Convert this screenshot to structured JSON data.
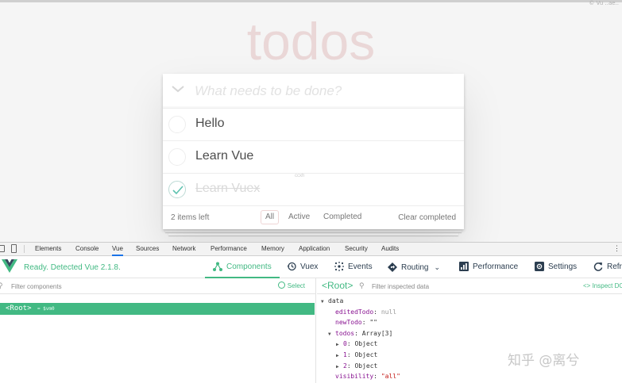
{
  "app": {
    "corner_text": "© Vu ..ae..",
    "title": "todos",
    "new_todo_placeholder": "What needs to be done?",
    "toggle_all_glyph": "❯",
    "todos": [
      {
        "title": "Hello",
        "completed": false
      },
      {
        "title": "Learn Vue",
        "completed": false
      },
      {
        "title": "Learn Vuex",
        "completed": true
      }
    ],
    "mid_watermark": "ccxh",
    "footer": {
      "items_left": "2 items left",
      "filters": [
        "All",
        "Active",
        "Completed"
      ],
      "selected_filter": "All",
      "clear_completed": "Clear completed"
    },
    "colors": {
      "title": "#e8c9c9",
      "check": "#5dc2af"
    }
  },
  "devtools": {
    "tabs": [
      "Elements",
      "Console",
      "Vue",
      "Sources",
      "Network",
      "Performance",
      "Memory",
      "Application",
      "Security",
      "Audits"
    ],
    "active_tab": "Vue",
    "menu_glyph": "⋮",
    "vue": {
      "ready_text": "Ready. Detected Vue 2.1.8.",
      "tabs": [
        {
          "label": "Components",
          "icon": "components-icon",
          "active": true
        },
        {
          "label": "Vuex",
          "icon": "history-icon",
          "active": false
        },
        {
          "label": "Events",
          "icon": "events-icon",
          "active": false
        },
        {
          "label": "Routing",
          "icon": "routing-icon",
          "active": false
        },
        {
          "label": "Performance",
          "icon": "performance-icon",
          "active": false
        },
        {
          "label": "Settings",
          "icon": "settings-icon",
          "active": false
        },
        {
          "label": "Refresh",
          "icon": "refresh-icon",
          "active": false
        }
      ],
      "filter_components_placeholder": "Filter components",
      "select_label": "Select",
      "root_component": "<Root>",
      "root_var": "= $vm0",
      "inspected_tag": "<Root>",
      "filter_inspected_placeholder": "Filter inspected data",
      "inspect_dom": "<> Inspect DOM",
      "data_tree": {
        "section": "data",
        "edited_key": "editedTodo",
        "edited_val": "null",
        "newtodo_key": "newTodo",
        "newtodo_val": "\"\"",
        "todos_key": "todos",
        "todos_val": "Array[3]",
        "items": [
          {
            "key": "0",
            "val": "Object"
          },
          {
            "key": "1",
            "val": "Object"
          },
          {
            "key": "2",
            "val": "Object"
          }
        ],
        "visibility_key": "visibility",
        "visibility_val": "\"all\""
      },
      "colors": {
        "accent": "#42b983",
        "text": "#2c3e50"
      }
    }
  },
  "watermark": "知乎 @离兮"
}
